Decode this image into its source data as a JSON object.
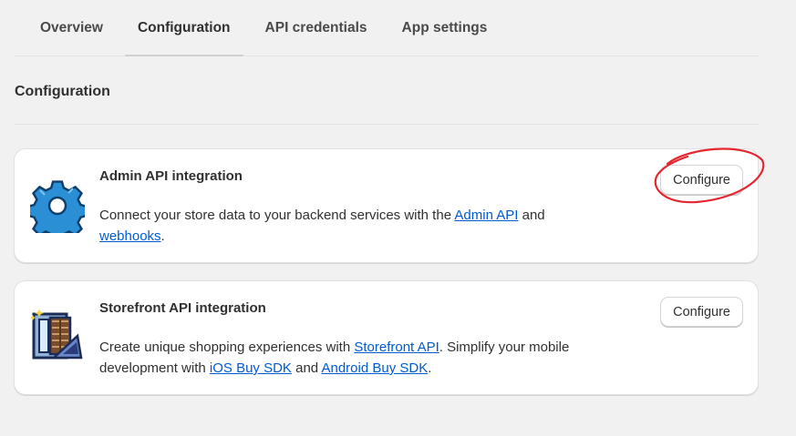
{
  "tabs": [
    {
      "label": "Overview",
      "active": false
    },
    {
      "label": "Configuration",
      "active": true
    },
    {
      "label": "API credentials",
      "active": false
    },
    {
      "label": "App settings",
      "active": false
    }
  ],
  "section": {
    "title": "Configuration"
  },
  "cards": {
    "admin": {
      "title": "Admin API integration",
      "icon": "gear-icon",
      "desc_part1": "Connect your store data to your backend services with the ",
      "link_admin_api": "Admin API",
      "desc_part2": " and ",
      "link_webhooks": "webhooks",
      "desc_part3": ".",
      "button_label": "Configure"
    },
    "storefront": {
      "title": "Storefront API integration",
      "icon": "storefront-icon",
      "desc_part1": "Create unique shopping experiences with ",
      "link_storefront_api": "Storefront API",
      "desc_part2": ". Simplify your mobile development with ",
      "link_ios_sdk": "iOS Buy SDK",
      "desc_part3": " and ",
      "link_android_sdk": "Android Buy SDK",
      "desc_part4": ".",
      "button_label": "Configure"
    }
  },
  "colors": {
    "background": "#f1f1f1",
    "link": "#005bd3",
    "annotation": "#e3262f",
    "gear": "#2b8fd6"
  }
}
